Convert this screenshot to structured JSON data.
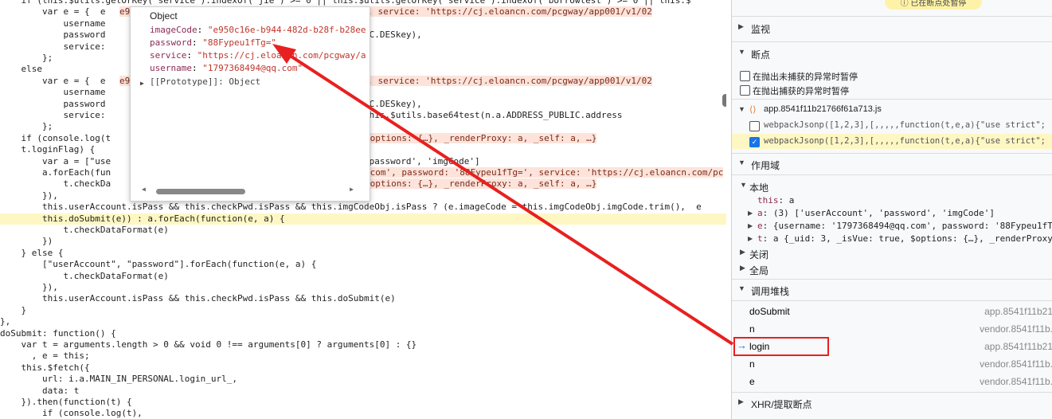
{
  "code_lines": [
    "    if (this.$utils.getOrKey('service').indexOf('jie') >= 0 || this.$utils.getOrKey('service').indexOf('borrowtest') >= 0 || this.$",
    "        var e = {  e                   ...",
    "            username",
    "            password                                  .trim(), r.PUBLIC.DESkey),",
    "            service:",
    "        };",
    "    else",
    "        var e = {  e",
    "            username",
    "            password                                  .trim(), r.PUBLIC.DESkey),",
    "            service:                                  /v1/02?ret=\" + this.$utils.base64test(n.a.ADDRESS_PUBLIC.address",
    "        };",
    "    if (console.log(t",
    "    t.loginFlag) {",
    "        var a = [\"use                                 'userAccount', 'password', 'imgCode']",
    "        a.forEach(fun",
    "            t.checkDa",
    "        }),",
    "        this.userAccount.isPass && this.checkPwd.isPass && this.imgCodeObj.isPass ? (e.imageCode = this.imgCodeObj.imgCode.trim(),  e",
    "        this.doSubmit(e)) : a.forEach(function(e, a) {",
    "            t.checkDataFormat(e)",
    "        })",
    "    } else {",
    "        [\"userAccount\", \"password\"].forEach(function(e, a) {",
    "            t.checkDataFormat(e)",
    "        }),",
    "        this.userAccount.isPass && this.checkPwd.isPass && this.doSubmit(e)",
    "    }",
    "},",
    "doSubmit: function() {",
    "    var t = arguments.length > 0 && void 0 !== arguments[0] ? arguments[0] : {}",
    "      , e = this;",
    "    this.$fetch({",
    "        url: i.a.MAIN_IN_PERSONAL.login_url_,",
    "        data: t",
    "    }).then(function(t) {",
    "        if (console.log(t),"
  ],
  "inline_values": {
    "line1": "e950c16e-b944-482d-b28f-b28ee...  88Fypeu1fTg=', service: 'https://cj.eloancn.com/pcgway/app001/v1/02",
    "line7": "e950c16e-b944-482d-b28f-b28ee...  88Fypeu1fTg=', service: 'https://cj.eloancn.com/pcgway/app001/v1/02",
    "line12": "$options: {…}, _renderProxy: a, _self: a, …}",
    "line15": "'com', password: '88Fypeu1fTg=', service: 'https://cj.eloancn.com/pc",
    "line16": "$options: {…}, _renderProxy: a, _self: a, …}"
  },
  "popup": {
    "title": "Object",
    "rows": [
      {
        "key": "imageCode",
        "value": "\"e950c16e-b944-482d-b28f-b28ee\""
      },
      {
        "key": "password",
        "value": "\"88Fypeu1fTg=\""
      },
      {
        "key": "service",
        "value": "\"https://cj.eloancn.com/pcgway/a"
      },
      {
        "key": "username",
        "value": "\"1797368494@qq.com\""
      }
    ],
    "proto": "[[Prototype]]: Object"
  },
  "panel": {
    "paused_badge": "已在断点处暂停",
    "watch": "监视",
    "breakpoints": "断点",
    "pause_uncaught": "在抛出未捕获的异常时暂停",
    "pause_caught": "在抛出捕获的异常时暂停",
    "bp_file": "app.8541f11b21766f61a713.js",
    "bp_items": [
      "webpackJsonp([1,2,3],[,,,,,function(t,e,a){\"use strict\";",
      "webpackJsonp([1,2,3],[,,,,,function(t,e,a){\"use strict\";"
    ],
    "scope": "作用域",
    "local": "本地",
    "scope_items": [
      {
        "key": "this",
        "val": "a"
      },
      {
        "key": "a",
        "val": "(3) ['userAccount', 'password', 'imgCode']"
      },
      {
        "key": "e",
        "val": "{username: '1797368494@qq.com', password: '88Fypeu1fTg"
      },
      {
        "key": "t",
        "val": "a {_uid: 3, _isVue: true, $options: {…}, _renderProxy"
      }
    ],
    "closure": "关闭",
    "global": "全局",
    "callstack": "调用堆栈",
    "stack": [
      {
        "fn": "doSubmit",
        "loc": "app.8541f11b21"
      },
      {
        "fn": "n",
        "loc": "vendor.8541f11b."
      },
      {
        "fn": "login",
        "loc": "app.8541f11b21"
      },
      {
        "fn": "n",
        "loc": "vendor.8541f11b."
      },
      {
        "fn": "e",
        "loc": "vendor.8541f11b."
      }
    ],
    "xhr": "XHR/提取断点"
  },
  "colors": {
    "annotation": "#e8201f",
    "highlight_line": "#fef7c3",
    "accent": "#1a73e8"
  }
}
